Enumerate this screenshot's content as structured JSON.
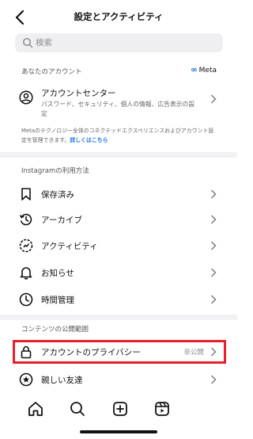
{
  "header": {
    "title": "設定とアクティビティ"
  },
  "search": {
    "placeholder": "検索"
  },
  "accounts_section": {
    "label": "あなたのアカウント",
    "brand": "Meta",
    "account_center": {
      "title": "アカウントセンター",
      "description": "パスワード、セキュリティ、個人の情報、広告表示の設定"
    },
    "note": "Metaのテクノロジー全体のコネクテッドエクスペリエンスおよびアカウント設定を管理できます。",
    "note_link": "詳しくはこちら"
  },
  "usage_section": {
    "label": "Instagramの利用方法",
    "items": [
      {
        "label": "保存済み",
        "icon": "bookmark-icon"
      },
      {
        "label": "アーカイブ",
        "icon": "archive-icon"
      },
      {
        "label": "アクティビティ",
        "icon": "activity-icon"
      },
      {
        "label": "お知らせ",
        "icon": "bell-icon"
      },
      {
        "label": "時間管理",
        "icon": "clock-icon"
      }
    ]
  },
  "content_section": {
    "label": "コンテンツの公開範囲",
    "items": [
      {
        "label": "アカウントのプライバシー",
        "value": "非公開",
        "icon": "lock-icon"
      },
      {
        "label": "親しい友達",
        "icon": "star-circle-icon"
      }
    ]
  },
  "tabbar": [
    "home-icon",
    "search-icon",
    "create-icon",
    "reels-icon"
  ],
  "colors": {
    "highlight": "#e8202a",
    "link": "#1a73e8",
    "meta_blue": "#0668e1"
  }
}
